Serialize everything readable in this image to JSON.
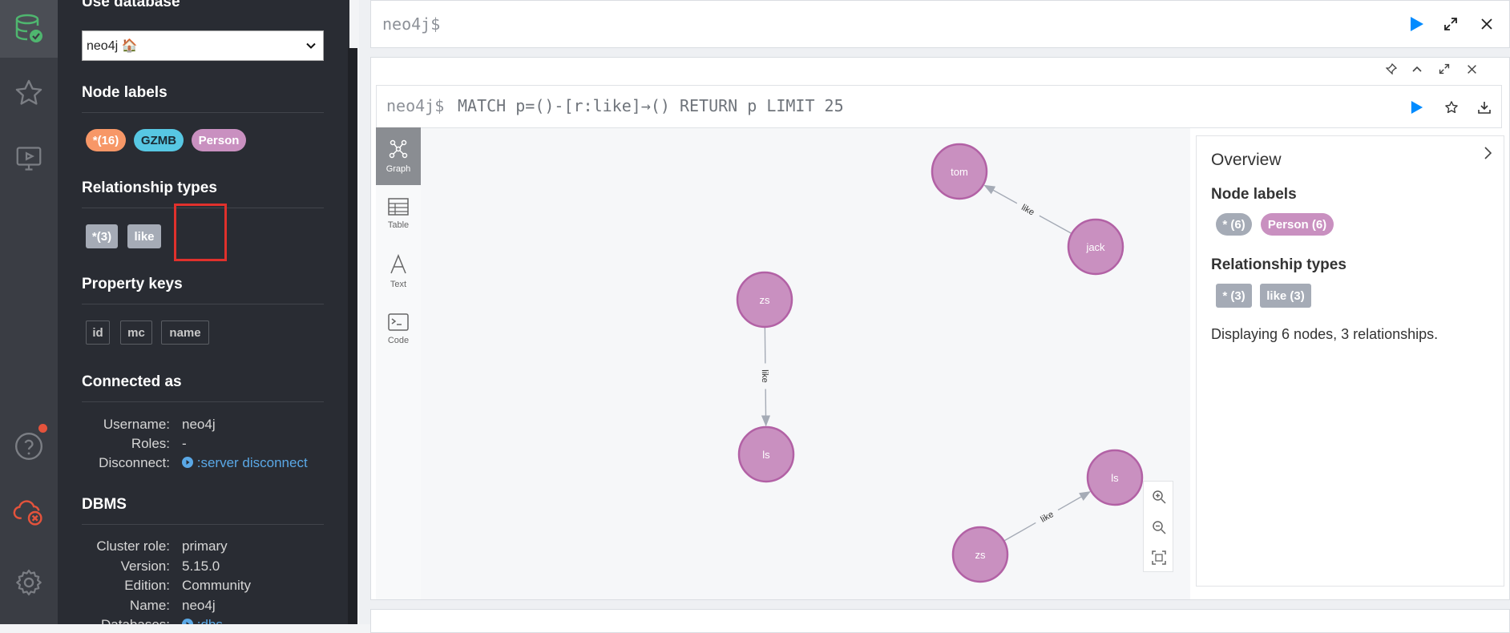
{
  "colors": {
    "accent": "#018bff",
    "node_purple": "#c990c0",
    "node_stroke": "#b261a5",
    "pill_all": "#f79767",
    "pill_gzmb": "#57c7e3",
    "rel_grey": "#a5abb6",
    "highlight_red": "#e0312c",
    "link_blue": "#5aa8e6"
  },
  "rail": {
    "icons": [
      "database-icon",
      "star-icon",
      "monitor-play-icon",
      "help-icon",
      "cloud-disconnected-icon",
      "settings-icon"
    ]
  },
  "sidebar": {
    "use_database_heading": "Use database",
    "database_selected": "neo4j 🏠",
    "node_labels_heading": "Node labels",
    "node_labels": [
      "*(16)",
      "GZMB",
      "Person"
    ],
    "relationship_types_heading": "Relationship types",
    "relationship_types": [
      "*(3)",
      "like"
    ],
    "property_keys_heading": "Property keys",
    "property_keys": [
      "id",
      "mc",
      "name"
    ],
    "connected_as_heading": "Connected as",
    "username_label": "Username:",
    "username": "neo4j",
    "roles_label": "Roles:",
    "roles": "-",
    "disconnect_label": "Disconnect:",
    "disconnect_link": ":server disconnect",
    "dbms_heading": "DBMS",
    "cluster_role_label": "Cluster role:",
    "cluster_role": "primary",
    "version_label": "Version:",
    "version": "5.15.0",
    "edition_label": "Edition:",
    "edition": "Community",
    "name_label": "Name:",
    "name": "neo4j",
    "databases_label": "Databases:",
    "databases_link": ":dbs"
  },
  "editor": {
    "prompt": "neo4j$"
  },
  "result": {
    "prompt": "neo4j$",
    "query": "MATCH p=()-[r:like]→() RETURN p LIMIT 25",
    "view_tabs": [
      "Graph",
      "Table",
      "Text",
      "Code"
    ],
    "active_tab": "Graph",
    "graph": {
      "nodes": [
        {
          "id": "n1",
          "caption": "tom"
        },
        {
          "id": "n2",
          "caption": "jack"
        },
        {
          "id": "n3",
          "caption": "zs"
        },
        {
          "id": "n4",
          "caption": "ls"
        },
        {
          "id": "n5",
          "caption": "ls"
        },
        {
          "id": "n6",
          "caption": "zs"
        }
      ],
      "relationships": [
        {
          "from": "n2",
          "to": "n1",
          "type": "like"
        },
        {
          "from": "n3",
          "to": "n4",
          "type": "like"
        },
        {
          "from": "n6",
          "to": "n5",
          "type": "like"
        }
      ]
    },
    "overview": {
      "title": "Overview",
      "node_labels_heading": "Node labels",
      "node_labels": [
        "* (6)",
        "Person (6)"
      ],
      "relationship_types_heading": "Relationship types",
      "relationship_types": [
        "* (3)",
        "like (3)"
      ],
      "summary": "Displaying 6 nodes, 3 relationships."
    }
  }
}
